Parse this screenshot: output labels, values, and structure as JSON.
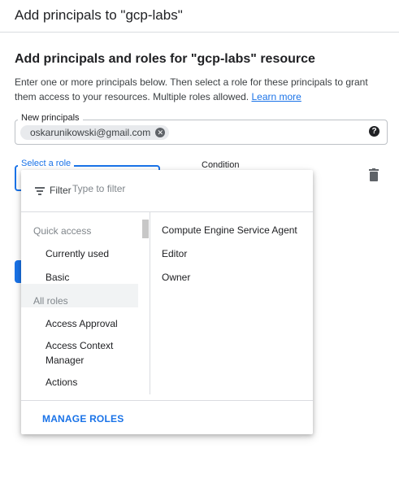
{
  "header": {
    "title": "Add principals to \"gcp-labs\""
  },
  "section": {
    "title": "Add principals and roles for \"gcp-labs\" resource",
    "description": "Enter one or more principals below. Then select a role for these principals to grant them access to your resources. Multiple roles allowed.",
    "learn_more": "Learn more"
  },
  "principals": {
    "label": "New principals",
    "chips": [
      "oskarunikowski@gmail.com"
    ],
    "help_icon": "help-icon"
  },
  "role": {
    "label": "Select a role",
    "condition_label": "Condition",
    "delete_icon": "trash-icon"
  },
  "dropdown": {
    "filter_label": "Filter",
    "filter_placeholder": "Type to filter",
    "left_groups": [
      {
        "label": "Quick access",
        "items": [
          "Currently used",
          "Basic"
        ]
      },
      {
        "label": "All roles",
        "items": [
          "Access Approval",
          "Access Context Manager",
          "Actions"
        ]
      }
    ],
    "selected_left_item": "Currently used",
    "right_items": [
      "Compute Engine Service Agent",
      "Editor",
      "Owner"
    ],
    "footer_action": "MANAGE ROLES"
  },
  "colors": {
    "accent": "#1a73e8",
    "text": "#202124",
    "muted": "#80868b",
    "divider": "#dadce0",
    "selected_bg": "#f1f3f4"
  }
}
